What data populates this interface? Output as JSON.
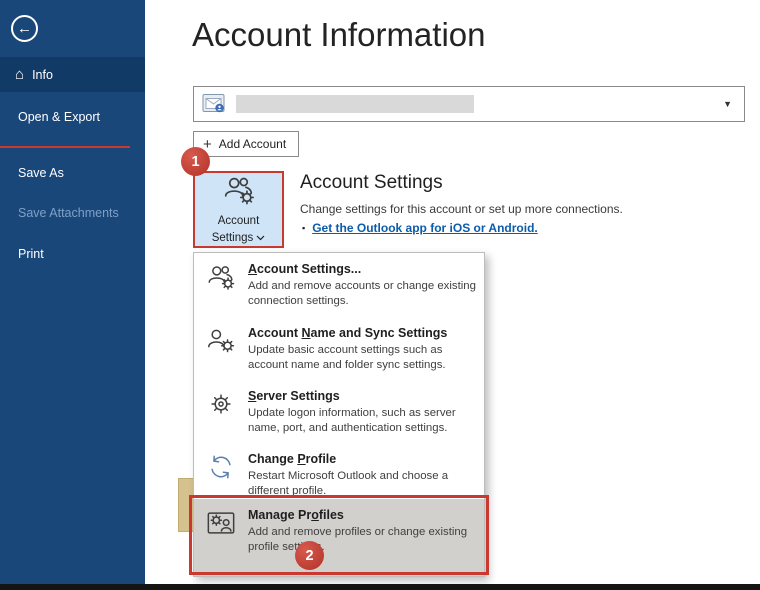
{
  "header": {
    "title": "Account Information"
  },
  "sidebar": {
    "items": [
      {
        "label": "Info",
        "active": true
      },
      {
        "label": "Open & Export"
      },
      {
        "label": "Save As"
      },
      {
        "label": "Save Attachments",
        "disabled": true
      },
      {
        "label": "Print"
      }
    ]
  },
  "account_bar": {
    "add_account_label": "Add Account"
  },
  "account_settings_button": {
    "label_line1": "Account",
    "label_line2": "Settings"
  },
  "account_settings_section": {
    "heading": "Account Settings",
    "description": "Change settings for this account or set up more connections.",
    "link_text": "Get the Outlook app for iOS or Android."
  },
  "menu": {
    "items": [
      {
        "pre": "",
        "key": "A",
        "post": "ccount Settings...",
        "description": "Add and remove accounts or change existing connection settings."
      },
      {
        "pre": "Account ",
        "key": "N",
        "post": "ame and Sync Settings",
        "description": "Update basic account settings such as account name and folder sync settings."
      },
      {
        "pre": "",
        "key": "S",
        "post": "erver Settings",
        "description": "Update logon information, such as server name, port, and authentication settings."
      },
      {
        "pre": "Change ",
        "key": "P",
        "post": "rofile",
        "description": "Restart Microsoft Outlook and choose a different profile."
      },
      {
        "pre": "Manage Pr",
        "key": "o",
        "post": "files",
        "description": "Add and remove profiles or change existing profile settings."
      }
    ]
  },
  "annotations": {
    "step1": "1",
    "step2": "2"
  },
  "icons": {
    "back": "←",
    "home": "⌂",
    "dropdown_arrow": "▼",
    "plus": "+",
    "bullet": "▪"
  },
  "colors": {
    "sidebar_blue": "#19477a",
    "sidebar_active_blue": "#123a66",
    "annotation_red": "#c9392f",
    "link_blue": "#0b5cab",
    "button_highlight_blue": "#cfe4f7",
    "menu_hover_gray": "#d2d0cd"
  }
}
